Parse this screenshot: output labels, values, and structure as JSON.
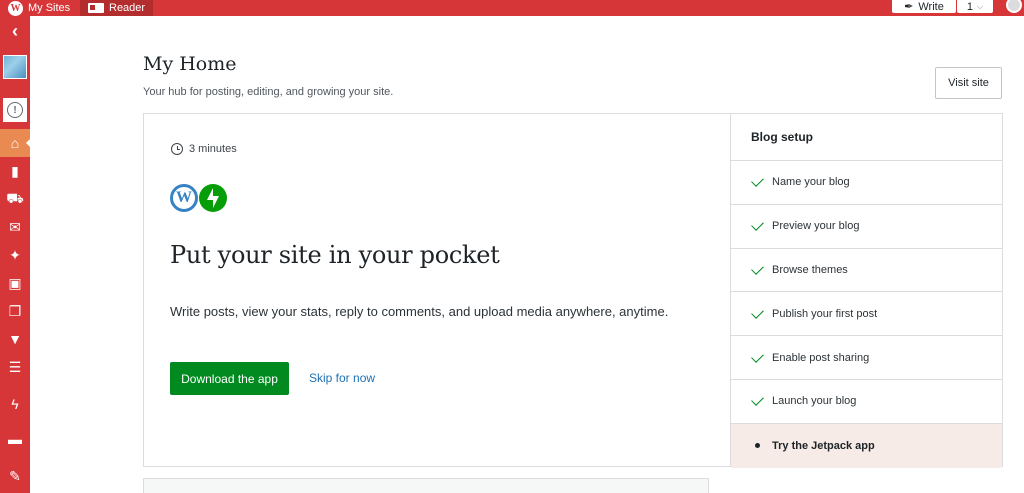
{
  "masterbar": {
    "my_sites_label": "My Sites",
    "reader_label": "Reader",
    "write_label": "Write",
    "notification_count": "1"
  },
  "sidebar": {
    "items": [
      {
        "icon": "back-chevron-icon",
        "glyph": "‹"
      },
      {
        "icon": "home-icon",
        "glyph": "⌂",
        "active": true
      },
      {
        "icon": "stats-icon",
        "glyph": "▮"
      },
      {
        "icon": "cart-icon",
        "glyph": "🛒"
      },
      {
        "icon": "mail-icon",
        "glyph": "✉"
      },
      {
        "icon": "pin-icon",
        "glyph": "📌"
      },
      {
        "icon": "media-icon",
        "glyph": "▣"
      },
      {
        "icon": "pages-icon",
        "glyph": "❐"
      },
      {
        "icon": "comments-icon",
        "glyph": "▼"
      },
      {
        "icon": "feedback-icon",
        "glyph": "☰"
      },
      {
        "icon": "jetpack-icon",
        "glyph": "ϟ"
      },
      {
        "icon": "woo-icon",
        "glyph": "▬"
      },
      {
        "icon": "tools-icon",
        "glyph": "✎"
      }
    ]
  },
  "header": {
    "title": "My Home",
    "subtitle": "Your hub for posting, editing, and growing your site.",
    "visit_site_label": "Visit site"
  },
  "card": {
    "time_estimate": "3 minutes",
    "heading": "Put your site in your pocket",
    "description": "Write posts, view your stats, reply to comments, and upload media anywhere, anytime.",
    "primary_button": "Download the app",
    "secondary_link": "Skip for now"
  },
  "checklist": {
    "title": "Blog setup",
    "items": [
      {
        "label": "Name your blog",
        "done": true
      },
      {
        "label": "Preview your blog",
        "done": true
      },
      {
        "label": "Browse themes",
        "done": true
      },
      {
        "label": "Publish your first post",
        "done": true
      },
      {
        "label": "Enable post sharing",
        "done": true
      },
      {
        "label": "Launch your blog",
        "done": true
      },
      {
        "label": "Try the Jetpack app",
        "done": false
      }
    ]
  },
  "colors": {
    "brand": "#d63638",
    "accent_active": "#e88a52",
    "primary_button": "#008a20",
    "link": "#2271b1",
    "current_step_bg": "#f6ebe6"
  }
}
